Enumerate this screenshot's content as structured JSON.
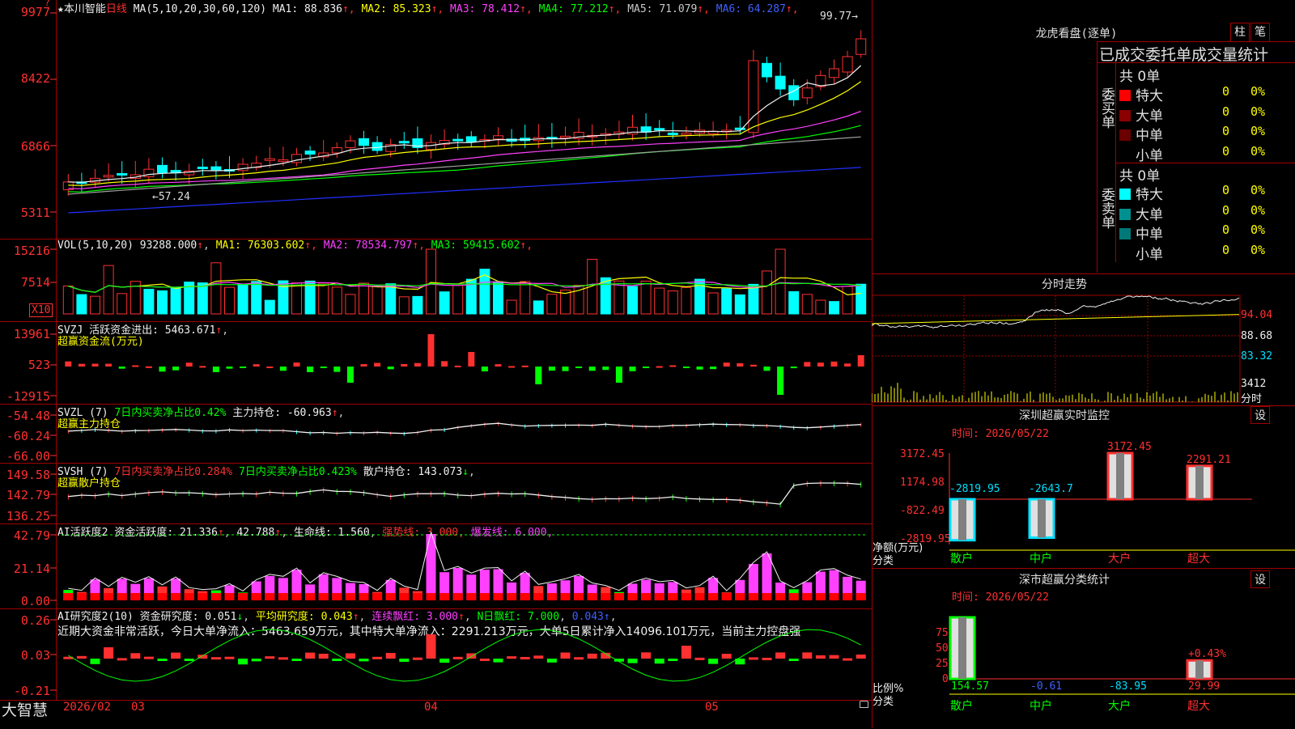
{
  "stock": {
    "name": "本川智能",
    "period": "日线",
    "star": "★"
  },
  "price_panel": {
    "ma_header": "MA(5,10,20,30,60,120)",
    "ma": [
      {
        "label": "MA1:",
        "value": "88.836",
        "arrow": "↑",
        "color": "#f0f0f0"
      },
      {
        "label": "MA2:",
        "value": "85.323",
        "arrow": "↑",
        "color": "#ffff00"
      },
      {
        "label": "MA3:",
        "value": "78.412",
        "arrow": "↑",
        "color": "#ff40ff"
      },
      {
        "label": "MA4:",
        "value": "77.212",
        "arrow": "↑",
        "color": "#00ff00"
      },
      {
        "label": "MA5:",
        "value": "71.079",
        "arrow": "↑",
        "color": "#c8c8c8"
      },
      {
        "label": "MA6:",
        "value": "64.287",
        "arrow": "↑",
        "color": "#4060ff"
      }
    ],
    "y_labels": [
      "9977",
      "8422",
      "6866",
      "5311"
    ],
    "high_label": "99.77",
    "low_label": "57.24"
  },
  "vol_panel": {
    "header": "VOL(5,10,20)",
    "value": "93288.000",
    "ma": [
      {
        "label": "MA1:",
        "value": "76303.602",
        "color": "#ffff00"
      },
      {
        "label": "MA2:",
        "value": "78534.797",
        "color": "#ff40ff"
      },
      {
        "label": "MA3:",
        "value": "59415.602",
        "color": "#00ff00"
      }
    ],
    "y_labels": [
      "15216",
      "7514"
    ],
    "unit": "X10"
  },
  "svzj_panel": {
    "header": "SVZJ",
    "label": "活跃资金进出:",
    "value": "5463.671",
    "subtitle": "超赢资金流(万元)",
    "y_labels": [
      "13961",
      "523",
      "-12915"
    ]
  },
  "svzl_panel": {
    "header": "SVZL (7)",
    "label1": "7日内买卖净占比0.42%",
    "label2": "主力持仓:",
    "value": "-60.963",
    "subtitle": "超赢主力持仓",
    "y_labels": [
      "-54.48",
      "-60.24",
      "-66.00"
    ]
  },
  "svsh_panel": {
    "header": "SVSH (7)",
    "label1": "7日内买卖净占比0.284%",
    "label2": "7日内买卖净占比0.423%",
    "label3": "散户持仓:",
    "value": "143.073",
    "subtitle": "超赢散户持仓",
    "y_labels": [
      "149.58",
      "142.79",
      "136.25"
    ]
  },
  "ai1_panel": {
    "header": "AI活跃度2",
    "label": "资金活跃度:",
    "value1": "21.336",
    "value2": "42.788",
    "life_label": "生命线:",
    "life_value": "1.560",
    "strong_label": "强势线:",
    "strong_value": "3.000",
    "burst_label": "爆发线:",
    "burst_value": "6.000",
    "y_labels": [
      "42.79",
      "21.14",
      "0.00"
    ]
  },
  "ai2_panel": {
    "header": "AI研究度2(10)",
    "label": "资金研究度:",
    "value": "0.051",
    "avg_label": "平均研究度:",
    "avg_value": "0.043",
    "red_label": "连续飘红:",
    "red_value": "3.000",
    "n_label": "N日飘红:",
    "n_value": "7.000",
    "last_value": "0.043",
    "comment": "近期大资金非常活跃，今日大单净流入：5463.659万元，其中特大单净流入：2291.213万元，大单5日累计净入14096.101万元，当前主力控盘强",
    "y_labels": [
      "0.26",
      "0.03",
      "-0.21"
    ]
  },
  "bottom_bar": {
    "brand": "大智慧",
    "dates": [
      "2026/02",
      "03",
      "04",
      "05"
    ]
  },
  "right": {
    "lhb_title": "龙虎看盘(逐单)",
    "btn_bar": "柱",
    "btn_pen": "笔",
    "tabs": "已成交委托单成交量统计",
    "buy_side": {
      "label": "委买单",
      "total": "共 0单",
      "rows": [
        {
          "label": "特大",
          "color": "#ff0000",
          "count": "0",
          "pct": "0%"
        },
        {
          "label": "大单",
          "color": "#8b0000",
          "count": "0",
          "pct": "0%"
        },
        {
          "label": "中单",
          "color": "#6b0000",
          "count": "0",
          "pct": "0%"
        },
        {
          "label": "小单",
          "color": "#000000",
          "count": "0",
          "pct": "0%"
        }
      ]
    },
    "sell_side": {
      "label": "委卖单",
      "total": "共 0单",
      "rows": [
        {
          "label": "特大",
          "color": "#00ffff",
          "count": "0",
          "pct": "0%"
        },
        {
          "label": "大单",
          "color": "#009090",
          "count": "0",
          "pct": "0%"
        },
        {
          "label": "中单",
          "color": "#007878",
          "count": "0",
          "pct": "0%"
        },
        {
          "label": "小单",
          "color": "#000000",
          "count": "0",
          "pct": "0%"
        }
      ]
    },
    "intraday": {
      "title": "分时走势",
      "y_labels": [
        "94.04",
        "88.68",
        "83.32",
        "3412"
      ],
      "vol_label": "分时"
    },
    "monitor": {
      "title": "深圳超赢实时监控",
      "btn": "设",
      "time_label": "时间: 2026/05/22",
      "y_labels": [
        "3172.45",
        "1174.98",
        "-822.49",
        "-2819.95"
      ],
      "y_title": "净额(万元)",
      "x_title": "分类",
      "bars": [
        {
          "name": "散户",
          "value": "-2819.95"
        },
        {
          "name": "中户",
          "value": "-2643.7"
        },
        {
          "name": "大户",
          "value": "3172.45"
        },
        {
          "name": "超大",
          "value": "2291.21"
        }
      ]
    },
    "classify": {
      "title": "深市超赢分类统计",
      "btn": "设",
      "time_label": "时间: 2026/05/22",
      "y_labels": [
        "75",
        "50",
        "25",
        "0"
      ],
      "y_title": "比例%",
      "x_title": "分类",
      "top_label": "+0.43%",
      "bars": [
        {
          "name": "散户",
          "value": "154.57"
        },
        {
          "name": "中户",
          "value": "-0.61"
        },
        {
          "name": "大户",
          "value": "-83.95"
        },
        {
          "name": "超大",
          "value": "29.99"
        }
      ]
    }
  }
}
